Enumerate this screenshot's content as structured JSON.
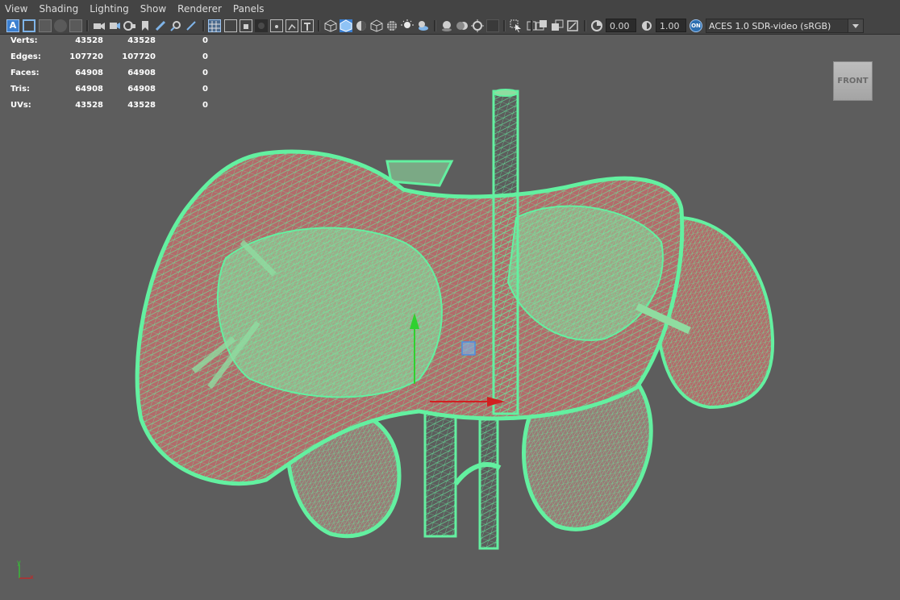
{
  "menu": [
    "View",
    "Shading",
    "Lighting",
    "Show",
    "Renderer",
    "Panels"
  ],
  "toolbar": {
    "exposure": "0.00",
    "gamma": "1.00",
    "color_space": "ACES 1.0 SDR-video (sRGB)"
  },
  "hud": {
    "rows": [
      {
        "label": "Verts:",
        "c1": "43528",
        "c2": "43528",
        "c3": "0"
      },
      {
        "label": "Edges:",
        "c1": "107720",
        "c2": "107720",
        "c3": "0"
      },
      {
        "label": "Faces:",
        "c1": "64908",
        "c2": "64908",
        "c3": "0"
      },
      {
        "label": "Tris:",
        "c1": "64908",
        "c2": "64908",
        "c3": "0"
      },
      {
        "label": "UVs:",
        "c1": "43528",
        "c2": "43528",
        "c3": "0"
      }
    ]
  },
  "viewcube": {
    "label": "FRONT"
  },
  "colors": {
    "wire": "#63f0a0",
    "interior": "#b36b6b",
    "viewport": "#5d5d5d",
    "panel": "#444444"
  }
}
